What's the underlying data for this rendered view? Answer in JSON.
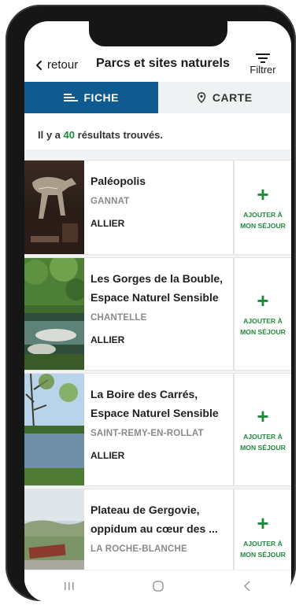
{
  "header": {
    "back_label": "retour",
    "title": "Parcs et sites naturels",
    "filter_label": "Filtrer"
  },
  "tabs": [
    {
      "label": "FICHE",
      "icon": "list-icon",
      "active": true
    },
    {
      "label": "CARTE",
      "icon": "map-pin-icon",
      "active": false
    }
  ],
  "results": {
    "prefix": "Il y a",
    "count": "40",
    "suffix": "résultats trouvés."
  },
  "items": [
    {
      "name": "Paléopolis",
      "city": "GANNAT",
      "department": "ALLIER",
      "image": "dinosaur-skeleton"
    },
    {
      "name": "Les Gorges de la Bouble, Espace Naturel Sensible",
      "city": "CHANTELLE",
      "department": "ALLIER",
      "image": "river-gorge"
    },
    {
      "name": "La Boire des Carrés, Espace Naturel Sensible",
      "city": "SAINT-REMY-EN-ROLLAT",
      "department": "ALLIER",
      "image": "lake-trees"
    },
    {
      "name": "Plateau de Gergovie, oppidum au cœur des ...",
      "city": "LA ROCHE-BLANCHE",
      "department": "",
      "image": "plateau-view"
    }
  ],
  "add_button": {
    "line1": "AJOUTER À",
    "line2": "MON SÉJOUR",
    "icon": "plus-icon"
  },
  "colors": {
    "accent": "#0f5a8e",
    "green": "#1f8a3b"
  },
  "nav": [
    "recent-apps-icon",
    "home-icon",
    "back-icon"
  ]
}
